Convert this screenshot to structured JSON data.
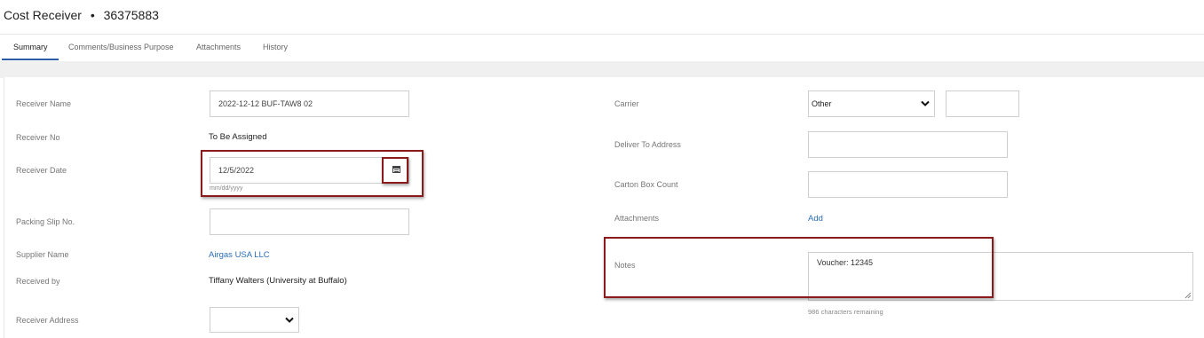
{
  "header": {
    "title": "Cost Receiver",
    "separator": "•",
    "number": "36375883"
  },
  "tabs": [
    {
      "label": "Summary"
    },
    {
      "label": "Comments/Business Purpose"
    },
    {
      "label": "Attachments"
    },
    {
      "label": "History"
    }
  ],
  "left": {
    "receiver_name": {
      "label": "Receiver Name",
      "value": "2022-12-12 BUF-TAW8 02"
    },
    "receiver_no": {
      "label": "Receiver No",
      "value": "To Be Assigned"
    },
    "receiver_date": {
      "label": "Receiver Date",
      "value": "12/5/2022",
      "hint": "mm/dd/yyyy"
    },
    "packing_slip": {
      "label": "Packing Slip No.",
      "value": ""
    },
    "supplier_name": {
      "label": "Supplier Name",
      "value": "Airgas USA LLC"
    },
    "received_by": {
      "label": "Received by",
      "value": "Tiffany Walters (University at Buffalo)"
    },
    "receiver_address": {
      "label": "Receiver Address",
      "value": ""
    }
  },
  "right": {
    "carrier": {
      "label": "Carrier",
      "value": "Other",
      "other_value": ""
    },
    "deliver_to": {
      "label": "Deliver To Address",
      "value": ""
    },
    "carton_count": {
      "label": "Carton Box Count",
      "value": ""
    },
    "attachments": {
      "label": "Attachments",
      "action": "Add"
    },
    "notes": {
      "label": "Notes",
      "value": "Voucher: 12345",
      "remaining": "986 characters remaining"
    }
  },
  "icons": {
    "calendar": "calendar-icon",
    "chevron": "chevron-down-icon"
  },
  "colors": {
    "highlight": "#8b1a1a",
    "link": "#2a6ebb",
    "tab_active": "#2a5ca8"
  }
}
